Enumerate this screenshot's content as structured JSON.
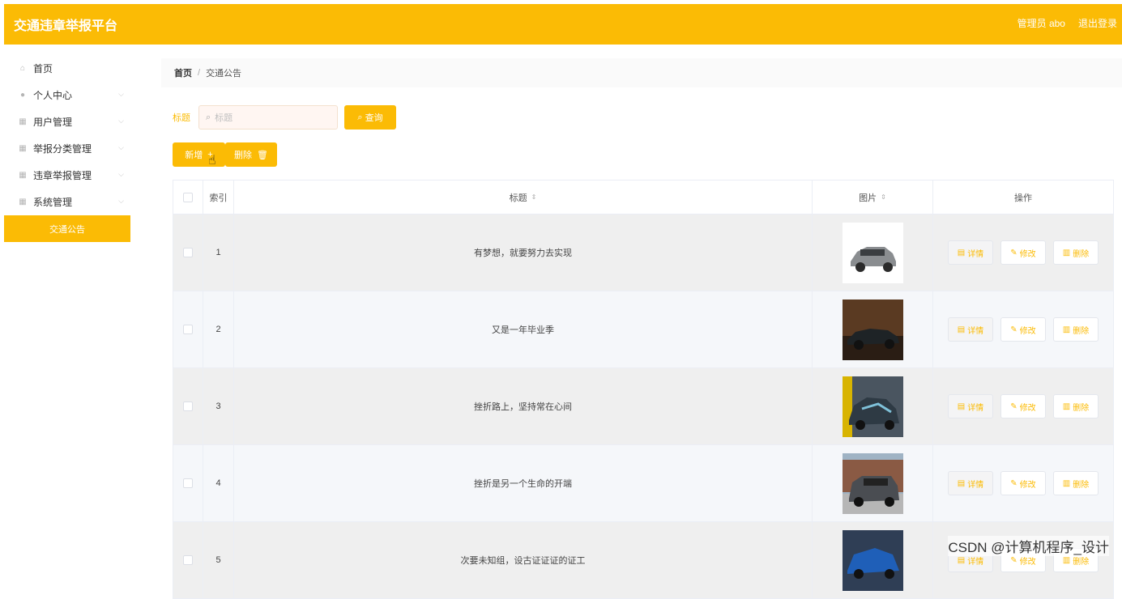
{
  "app": {
    "title": "交通违章举报平台"
  },
  "header": {
    "user": "管理员 abo",
    "logout": "退出登录"
  },
  "sidebar": {
    "items": [
      {
        "label": "首页",
        "icon": "home-icon",
        "has_children": false
      },
      {
        "label": "个人中心",
        "icon": "user-icon",
        "has_children": true
      },
      {
        "label": "用户管理",
        "icon": "grid-icon",
        "has_children": true
      },
      {
        "label": "举报分类管理",
        "icon": "grid-icon",
        "has_children": true
      },
      {
        "label": "违章举报管理",
        "icon": "grid-icon",
        "has_children": true
      },
      {
        "label": "系统管理",
        "icon": "grid-icon",
        "has_children": true
      }
    ],
    "active_sub": "交通公告"
  },
  "breadcrumb": {
    "home": "首页",
    "sep": "/",
    "current": "交通公告"
  },
  "search": {
    "label": "标题",
    "placeholder": "标题",
    "button": "查询"
  },
  "actions": {
    "add": "新增",
    "delete": "删除"
  },
  "table": {
    "headers": {
      "index": "索引",
      "title": "标题",
      "image": "图片",
      "ops": "操作"
    },
    "ops": {
      "detail": "详情",
      "edit": "修改",
      "delete": "删除"
    },
    "rows": [
      {
        "index": "1",
        "title": "有梦想，就要努力去实现"
      },
      {
        "index": "2",
        "title": "又是一年毕业季"
      },
      {
        "index": "3",
        "title": "挫折路上，坚持常在心间"
      },
      {
        "index": "4",
        "title": "挫折是另一个生命的开端"
      },
      {
        "index": "5",
        "title": "次要未知组，设古证证证的证工"
      }
    ]
  },
  "watermark": "CSDN @计算机程序_设计"
}
